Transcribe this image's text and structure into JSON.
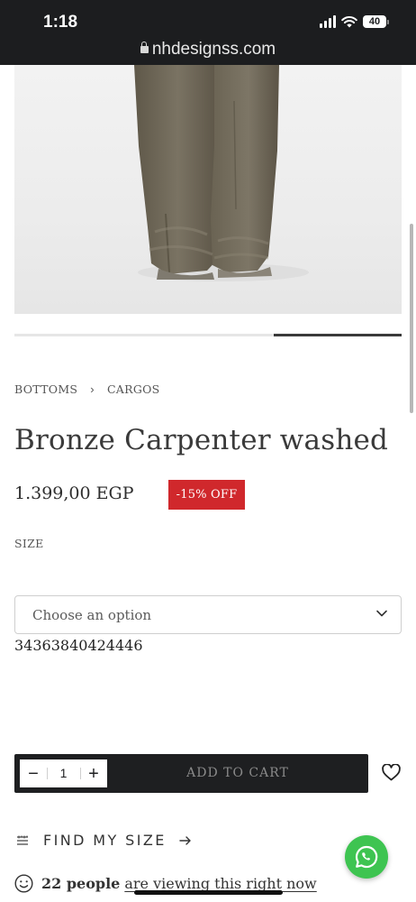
{
  "status_bar": {
    "time": "1:18",
    "battery": "40",
    "url": "nhdesignss.com"
  },
  "gallery": {
    "current_slide_progress": 0.33
  },
  "breadcrumb": {
    "items": [
      "BOTTOMS",
      "CARGOS"
    ],
    "separator": "›"
  },
  "product": {
    "title": "Bronze Carpenter washed",
    "price": "1.399,00 EGP",
    "discount": "-15% OFF",
    "size_label": "SIZE",
    "size_placeholder": "Choose an option",
    "variant_id": "34363840424446"
  },
  "cart": {
    "quantity": "1",
    "minus_label": "−",
    "plus_label": "+",
    "add_to_cart_label": "ADD TO CART"
  },
  "find_size": {
    "label": "FIND MY SIZE"
  },
  "viewing": {
    "count": "22 people",
    "rest": "are viewing this right now"
  },
  "colors": {
    "status_bar_bg": "#1c1d1f",
    "discount_badge": "#d0282c",
    "cart_bar": "#1e1f21",
    "whatsapp": "#3ec451"
  },
  "icons": [
    "lock-icon",
    "signal-icon",
    "wifi-icon",
    "battery-icon",
    "chevron-down-icon",
    "heart-icon",
    "ruler-icon",
    "arrow-right-icon",
    "smiley-icon",
    "whatsapp-icon"
  ]
}
